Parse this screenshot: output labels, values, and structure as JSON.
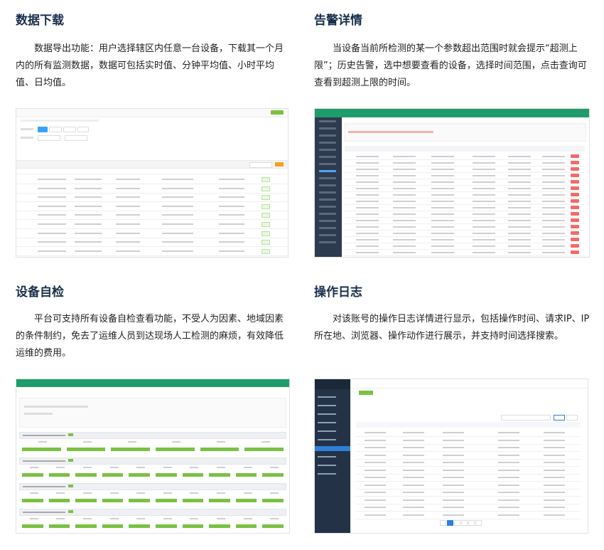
{
  "sections": [
    {
      "title": "数据下载",
      "desc": "数据导出功能：用户选择辖区内任意一台设备，下载其一个月内的所有监测数据，数据可包括实时值、分钟平均值、小时平均值、日均值。"
    },
    {
      "title": "告警详情",
      "desc": "当设备当前所检测的某一个参数超出范围时就会提示“超测上限”；历史告警，选中想要查看的设备，选择时间范围，点击查询可查看到超测上限的时间。"
    },
    {
      "title": "设备自检",
      "desc": "平台可支持所有设备自检查看功能，不受人为因素、地域因素的条件制约，免去了运维人员到达现场人工检测的麻烦，有效降低运维的费用。"
    },
    {
      "title": "操作日志",
      "desc": "对该账号的操作日志详情进行显示，包括操作时间、请求IP、IP所在地、浏览器、操作动作进行展示，并支持时间选择搜索。"
    }
  ],
  "colors": {
    "title": "#1a2f4c",
    "green": "#1f9c6b",
    "tag_green": "#7ac143",
    "alert_red": "#f26a6a",
    "dark_sidebar": "#2e3b4e",
    "blue": "#2f7fd8"
  },
  "screenshots": {
    "download": {
      "rows": 9
    },
    "alarm": {
      "rows": 16
    },
    "selfcheck": {
      "groups": 4
    },
    "oplog": {
      "rows": 12
    }
  }
}
